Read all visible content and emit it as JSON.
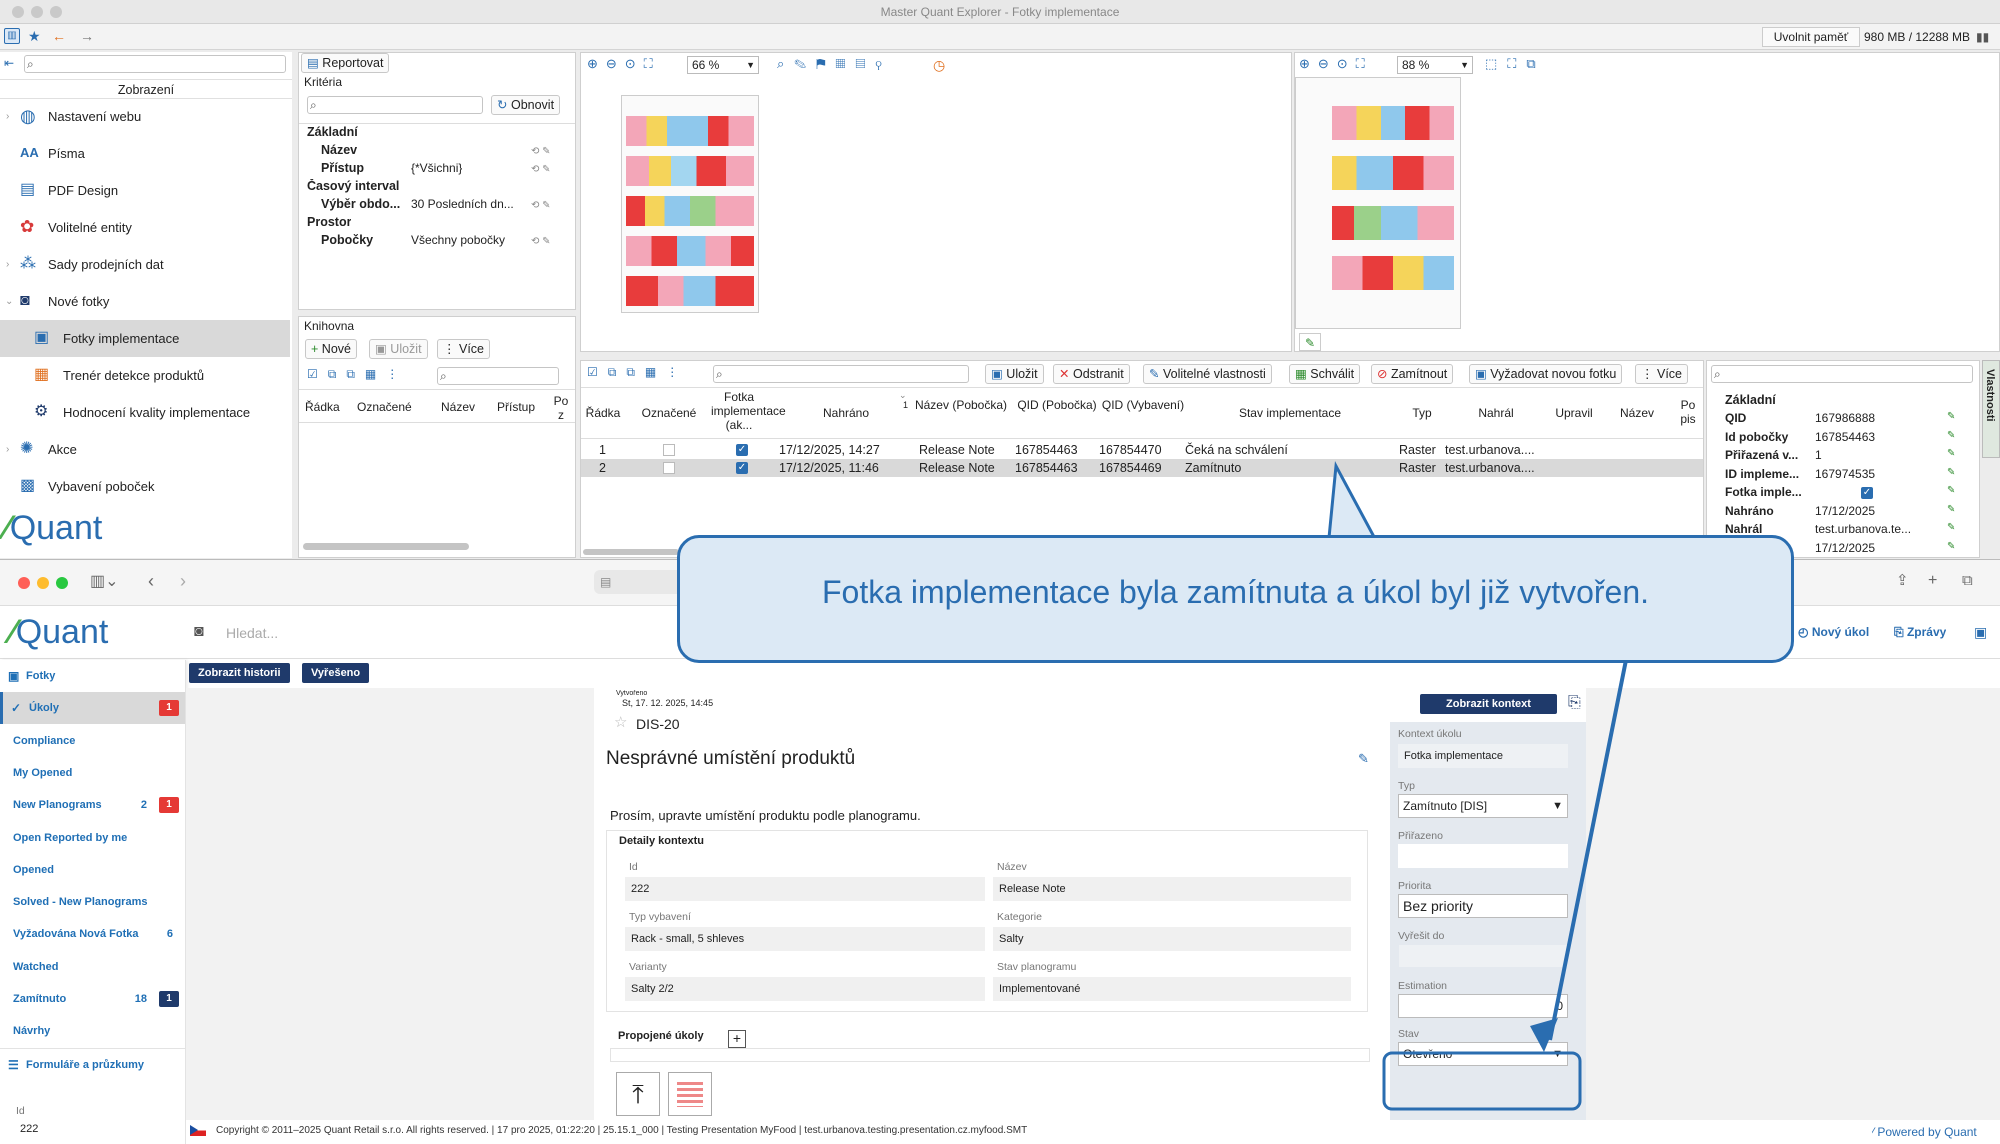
{
  "app": {
    "window_title": "Master Quant Explorer - Fotky implementace",
    "memory_button": "Uvolnit paměť",
    "memory_value": "980 MB / 12288 MB"
  },
  "nav": {
    "header": "Zobrazení",
    "items": [
      {
        "label": "Nastavení webu"
      },
      {
        "label": "Písma"
      },
      {
        "label": "PDF Design"
      },
      {
        "label": "Volitelné entity"
      },
      {
        "label": "Sady prodejních dat"
      },
      {
        "label": "Nové fotky"
      },
      {
        "label": "Fotky implementace"
      },
      {
        "label": "Trenér detekce produktů"
      },
      {
        "label": "Hodnocení kvality implementace"
      },
      {
        "label": "Akce"
      },
      {
        "label": "Vybavení poboček"
      }
    ],
    "logo": "Quant"
  },
  "criteria": {
    "report_button": "Reportovat",
    "title": "Kritéria",
    "refresh_button": "Obnovit",
    "groups": {
      "basic": "Základní",
      "name_key": "Název",
      "access_key": "Přístup",
      "access_value": "{*Všichni}",
      "time": "Časový interval",
      "period_key": "Výběr obdo...",
      "period_value": "30 Posledních dn...",
      "space": "Prostor",
      "branches_key": "Pobočky",
      "branches_value": "Všechny pobočky"
    }
  },
  "library": {
    "title": "Knihovna",
    "new_button": "Nové",
    "save_button": "Uložit",
    "more_button": "Více",
    "columns": [
      "Řádka",
      "Označené",
      "Název",
      "Přístup",
      "Po z"
    ]
  },
  "viewer_left": {
    "zoom": "66 %"
  },
  "viewer_right": {
    "zoom": "88 %"
  },
  "grid": {
    "toolbar": {
      "save": "Uložit",
      "remove": "Odstranit",
      "optional": "Volitelné vlastnosti",
      "approve": "Schválit",
      "reject": "Zamítnout",
      "request": "Vyžadovat novou fotku",
      "more": "Více"
    },
    "columns": [
      "Řádka",
      "Označené",
      "Fotka implementace (ak...",
      "Nahráno",
      "Název (Pobočka)",
      "QID (Pobočka)",
      "QID (Vybavení)",
      "Stav implementace",
      "Typ",
      "Nahrál",
      "Upravil",
      "Název",
      "Po pis"
    ],
    "sort_index": "1",
    "rows": [
      {
        "row": "1",
        "uploaded": "17/12/2025, 14:27",
        "name": "Release Note",
        "qid_branch": "167854463",
        "qid_equip": "167854470",
        "state": "Čeká na schválení",
        "type": "Raster",
        "by": "test.urbanova...."
      },
      {
        "row": "2",
        "uploaded": "17/12/2025, 11:46",
        "name": "Release Note",
        "qid_branch": "167854463",
        "qid_equip": "167854469",
        "state": "Zamítnuto",
        "type": "Raster",
        "by": "test.urbanova...."
      }
    ]
  },
  "properties": {
    "tab": "Vlastnosti",
    "group": "Základní",
    "items": [
      {
        "key": "QID",
        "value": "167986888"
      },
      {
        "key": "Id pobočky",
        "value": "167854463"
      },
      {
        "key": "Přiřazená v...",
        "value": "1"
      },
      {
        "key": "ID impleme...",
        "value": "167974535"
      },
      {
        "key": "Fotka imple...",
        "value": ""
      },
      {
        "key": "Nahráno",
        "value": "17/12/2025"
      },
      {
        "key": "Nahrál",
        "value": "test.urbanova.te..."
      },
      {
        "key": "",
        "value": "17/12/2025"
      }
    ]
  },
  "web": {
    "logo": "Quant",
    "search_placeholder": "Hledat...",
    "new_task": "Nový úkol",
    "messages": "Zprávy",
    "show_history": "Zobrazit historii",
    "resolved": "Vyřešeno",
    "sidebar": [
      {
        "label": "Fotky",
        "count": "",
        "badge": ""
      },
      {
        "label": "Úkoly",
        "count": "",
        "badge": "1"
      },
      {
        "label": "Compliance",
        "count": "",
        "badge": ""
      },
      {
        "label": "My Opened",
        "count": "",
        "badge": ""
      },
      {
        "label": "New Planograms",
        "count": "2",
        "badge": "1"
      },
      {
        "label": "Open Reported by me",
        "count": "",
        "badge": ""
      },
      {
        "label": "Opened",
        "count": "",
        "badge": ""
      },
      {
        "label": "Solved - New Planograms",
        "count": "",
        "badge": ""
      },
      {
        "label": "Vyžadována Nová Fotka",
        "count": "6",
        "badge": ""
      },
      {
        "label": "Watched",
        "count": "",
        "badge": ""
      },
      {
        "label": "Zamítnuto",
        "count": "18",
        "badge": "1"
      },
      {
        "label": "Návrhy",
        "count": "",
        "badge": ""
      },
      {
        "label": "Formuláře a průzkumy",
        "count": "",
        "badge": ""
      }
    ],
    "side_footer_label": "Id",
    "side_footer_value": "222",
    "task": {
      "created_label": "Vytvořeno",
      "created": "St, 17. 12. 2025, 14:45",
      "show_context": "Zobrazit kontext",
      "id": "DIS-20",
      "title": "Nesprávné umístění produktů",
      "description": "Prosím, upravte umístění produktu podle planogramu.",
      "details_title": "Detaily kontextu",
      "fields": [
        {
          "label": "Id",
          "value": "222"
        },
        {
          "label": "Název",
          "value": "Release Note"
        },
        {
          "label": "Typ vybavení",
          "value": "Rack - small, 5 shleves"
        },
        {
          "label": "Kategorie",
          "value": "Salty"
        },
        {
          "label": "Varianty",
          "value": "Salty 2/2"
        },
        {
          "label": "Stav planogramu",
          "value": "Implementované"
        }
      ],
      "linked": "Propojené úkoly"
    },
    "right": {
      "context_label": "Kontext úkolu",
      "context_value": "Fotka implementace",
      "type_label": "Typ",
      "type_value": "Zamítnuto [DIS]",
      "assigned_label": "Přiřazeno",
      "priority_label": "Priorita",
      "priority_value": "Bez priority",
      "due_label": "Vyřešit do",
      "estimation_label": "Estimation",
      "estimation_value": "0",
      "state_label": "Stav",
      "state_value": "Otevřeno"
    },
    "footer": "Copyright © 2011–2025 Quant Retail s.r.o. All rights reserved. | 17 pro 2025, 01:22:20 | 25.15.1_000 | Testing Presentation MyFood | test.urbanova.testing.presentation.cz.myfood.SMT",
    "powered": "Powered by Quant"
  },
  "callout": {
    "text": "Fotka implementace byla zamítnuta a úkol byl již vytvořen."
  },
  "colors": {
    "accent": "#2a6db0",
    "badge_red": "#e53935",
    "badge_navy": "#1f3a6b",
    "selected": "#d9d9d9"
  }
}
